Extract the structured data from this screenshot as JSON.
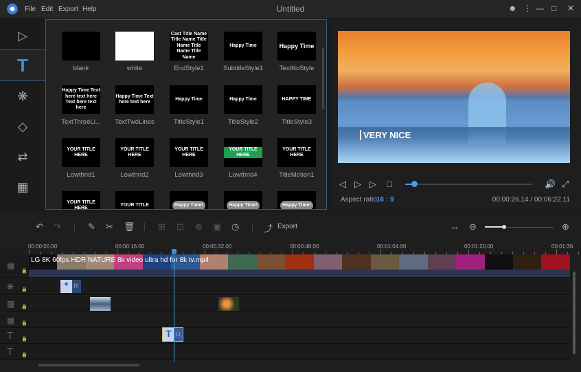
{
  "app": {
    "title": "Untitled",
    "menu": [
      "File",
      "Edit",
      "Export",
      "Help"
    ]
  },
  "sidebar": {
    "items": [
      {
        "icon": "media-icon"
      },
      {
        "icon": "text-icon",
        "active": true
      },
      {
        "icon": "filter-icon"
      },
      {
        "icon": "overlay-icon"
      },
      {
        "icon": "transition-icon"
      },
      {
        "icon": "film-icon"
      }
    ]
  },
  "library": {
    "tiles": [
      {
        "name": "blank",
        "preview": ""
      },
      {
        "name": "white",
        "preview": ""
      },
      {
        "name": "EndStyle1",
        "preview": "Cast Title Name Title Name Title Name Title Name Title Name"
      },
      {
        "name": "SubtitleStyle1",
        "preview": "Happy Time"
      },
      {
        "name": "TextNoStyle",
        "preview": "Happy Time"
      },
      {
        "name": "TextThreeLi...",
        "preview": "Happy Time Text here text here Text here text here"
      },
      {
        "name": "TextTwoLines",
        "preview": "Happy Time Text here text here"
      },
      {
        "name": "TitleStyle1",
        "preview": "Happy Time"
      },
      {
        "name": "TitleStyle2",
        "preview": "Happy Time"
      },
      {
        "name": "TitleStyle3",
        "preview": "HAPPY TIME"
      },
      {
        "name": "Lowthrid1",
        "preview": "YOUR TITLE HERE"
      },
      {
        "name": "Lowthrid2",
        "preview": "YOUR TITLE HERE"
      },
      {
        "name": "Lowthrid3",
        "preview": "YOUR TITLE HERE"
      },
      {
        "name": "Lowthrid4",
        "preview": "YOUR TITLE HERE"
      },
      {
        "name": "TitleMotion1",
        "preview": "YOUR TITLE HERE"
      },
      {
        "name": "",
        "preview": "YOUR TITLE HERE"
      },
      {
        "name": "",
        "preview": "YOUR TITLE"
      },
      {
        "name": "",
        "preview": "Happy Time!"
      },
      {
        "name": "",
        "preview": "Happy Time!"
      },
      {
        "name": "",
        "preview": "Happy Time!"
      }
    ]
  },
  "preview": {
    "overlay_text": "VERY NICE",
    "aspect_label": "Aspect ratio",
    "aspect_value": "16 : 9",
    "time": "00:00:26.14 / 00:06:22.11",
    "progress_percent": 7
  },
  "toolbar": {
    "export_label": "Export",
    "zoom_percent": 30
  },
  "timeline": {
    "ruler": [
      "00:00:00.00",
      "00:00:16.00",
      "00:00:32.00",
      "00:00:48.00",
      "00:01:04.00",
      "00:01:20.00",
      "00:01:36."
    ],
    "video_clip": "LG 8K 60fps HDR NATURE 8k video ultra hd for 8k tv.mp4",
    "effect_clip": "R",
    "text_clip": "U"
  },
  "colors": {
    "accent": "#3d8fe0",
    "panel_border": "#3a5a7a"
  }
}
